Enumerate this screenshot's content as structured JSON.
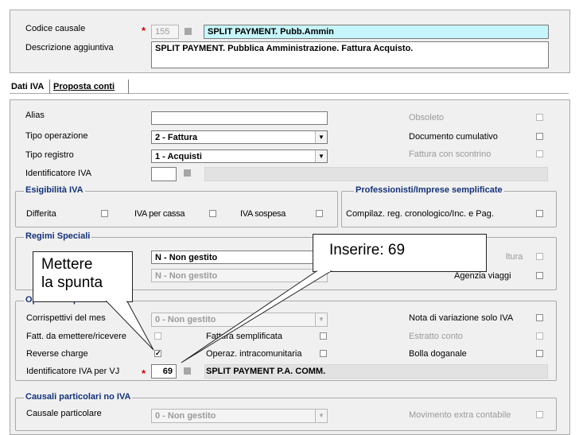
{
  "header": {
    "codice_label": "Codice causale",
    "codice_value": "155",
    "codice_desc": "SPLIT PAYMENT. Pubb.Ammin",
    "descrizione_label": "Descrizione aggiuntiva",
    "descrizione_value": "SPLIT PAYMENT. Pubblica Amministrazione. Fattura Acquisto."
  },
  "tabs": [
    {
      "label": "Dati IVA",
      "active": true
    },
    {
      "label": "Proposta conti",
      "active": false
    }
  ],
  "top": {
    "alias_label": "Alias",
    "alias_value": "",
    "tipo_operazione_label": "Tipo operazione",
    "tipo_operazione_value": "2 - Fattura",
    "tipo_registro_label": "Tipo registro",
    "tipo_registro_value": "1 - Acquisti",
    "identificatore_label": "Identificatore IVA",
    "identificatore_value": "",
    "obsoleto_label": "Obsoleto",
    "doc_cumulativo_label": "Documento cumulativo",
    "fattura_scontrino_label": "Fattura con scontrino"
  },
  "esigibilita": {
    "title": "Esigibilità IVA",
    "differita_label": "Differita",
    "iva_cassa_label": "IVA per cassa",
    "iva_sospesa_label": "IVA sospesa"
  },
  "professionisti": {
    "title": "Professionisti/Imprese semplificate",
    "compilaz_label": "Compilaz. reg. cronologico/Inc. e Pag."
  },
  "regimi": {
    "title": "Regimi Speciali",
    "select1_value": "N - Non gestito",
    "select2_value": "N - Non gestito",
    "fattura_partial_label": "ltura",
    "agenzia_viaggi_label": "Agenzia viaggi"
  },
  "operazioni": {
    "title_partial": "Operazioni par",
    "corrispettivi_label": "Corrispettivi del mes",
    "corrispettivi_value": "0 - Non gestito",
    "fatt_emettere_label": "Fatt. da emettere/ricevere",
    "fattura_semplificata_label": "Fattura semplificata",
    "fattura_semplificata_prefix": "Fatt",
    "reverse_charge_label": "Reverse charge",
    "reverse_charge_checked": true,
    "operaz_intra_label": "Operaz. intracomunitaria",
    "ident_vj_label": "Identificatore IVA per VJ",
    "ident_vj_value": "69",
    "ident_vj_desc": "SPLIT PAYMENT P.A. COMM.",
    "nota_variazione_label": "Nota di variazione solo IVA",
    "estratto_conto_label": "Estratto conto",
    "bolla_doganale_label": "Bolla doganale"
  },
  "causali": {
    "title": "Causali particolari no IVA",
    "causale_label": "Causale particolare",
    "causale_value": "0 - Non gestito",
    "movimento_label": "Movimento extra contabile"
  },
  "callouts": {
    "mettere_line1": "Mettere",
    "mettere_line2": "la spunta",
    "inserire": "Inserire: 69"
  },
  "colors": {
    "panel_bg": "#f0f0f0",
    "group_title": "#14327a",
    "required_star": "#d00000",
    "highlight_field": "#c6f6fb"
  }
}
